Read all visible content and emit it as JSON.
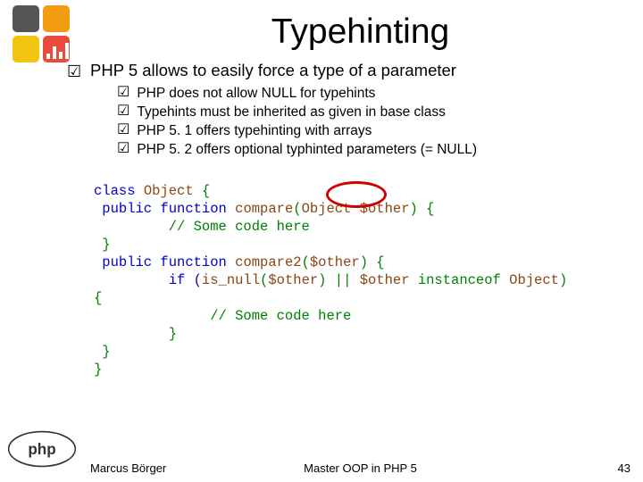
{
  "title": "Typehinting",
  "checkmark": "☑",
  "lead": "PHP 5 allows to easily force a type of a parameter",
  "sub": [
    "PHP does not allow NULL for typehints",
    "Typehints must be inherited as given in base class",
    "PHP 5. 1 offers typehinting with arrays",
    "PHP 5. 2 offers optional typhinted parameters (= NULL)"
  ],
  "code": {
    "l1a": "class ",
    "l1b": "Object ",
    "l1c": "{",
    "l2a": " public function ",
    "l2b": "compare",
    "l2c": "(",
    "l2d": "Object $other",
    "l2e": ") {",
    "l3": "         // Some code here",
    "l4": " }",
    "l5a": " public function ",
    "l5b": "compare2",
    "l5c": "(",
    "l5d": "$other",
    "l5e": ") {",
    "l6a": "         if (",
    "l6b": "is_null",
    "l6c": "(",
    "l6d": "$other",
    "l6e": ") || ",
    "l6f": "$other ",
    "l6g": "instanceof ",
    "l6h": "Object",
    "l6i": ")",
    "l7": "{",
    "l8": "              // Some code here",
    "l9": "         }",
    "l10": " }",
    "l11": "}"
  },
  "footer": {
    "left": "Marcus Börger",
    "mid": "Master OOP in PHP 5",
    "right": "43"
  }
}
